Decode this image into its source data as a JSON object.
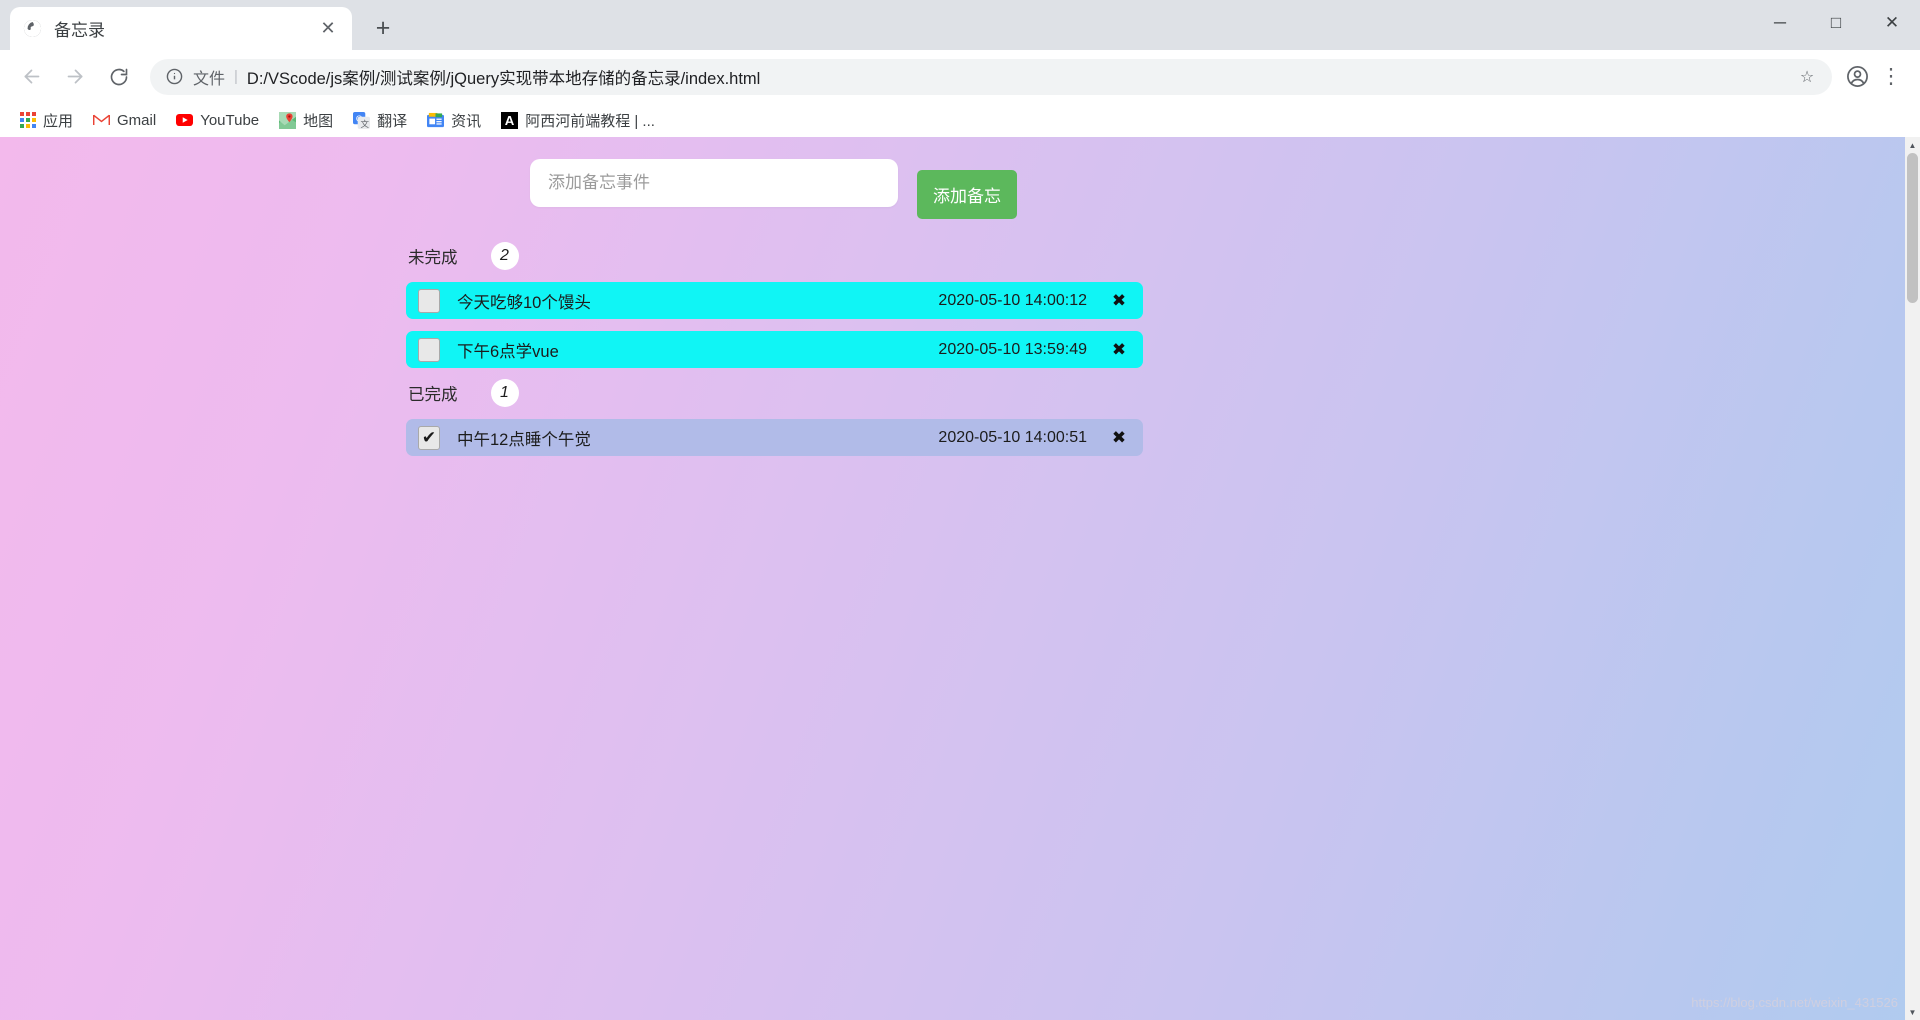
{
  "browser": {
    "tab": {
      "title": "备忘录",
      "favicon_icon": "globe-icon",
      "close_icon": "✕"
    },
    "newtab_icon": "+",
    "window_controls": {
      "minimize": "─",
      "maximize": "□",
      "close": "✕"
    },
    "toolbar": {
      "back_icon": "←",
      "forward_icon": "→",
      "reload_icon": "⟳",
      "info_icon": "ⓘ",
      "url_scheme_label": "文件",
      "url_separator": "|",
      "url_text": "D:/VScode/js案例/测试案例/jQuery实现带本地存储的备忘录/index.html",
      "star_icon": "☆",
      "profile_icon": "person-icon",
      "menu_icon": "⋮"
    },
    "bookmarks": [
      {
        "label": "应用",
        "icon": "apps-grid-icon"
      },
      {
        "label": "Gmail",
        "icon": "gmail-icon"
      },
      {
        "label": "YouTube",
        "icon": "youtube-icon"
      },
      {
        "label": "地图",
        "icon": "maps-icon"
      },
      {
        "label": "翻译",
        "icon": "translate-icon"
      },
      {
        "label": "资讯",
        "icon": "news-icon"
      },
      {
        "label": "阿西河前端教程 | ...",
        "icon": "letter-a-icon"
      }
    ]
  },
  "page": {
    "add": {
      "input_value": "",
      "input_placeholder": "添加备忘事件",
      "button_label": "添加备忘"
    },
    "sections": [
      {
        "title": "未完成",
        "count": "2",
        "items": [
          {
            "text": "今天吃够10个馒头",
            "time": "2020-05-10 14:00:12",
            "checked": false,
            "delete_icon": "✖"
          },
          {
            "text": "下午6点学vue",
            "time": "2020-05-10 13:59:49",
            "checked": false,
            "delete_icon": "✖"
          }
        ]
      },
      {
        "title": "已完成",
        "count": "1",
        "items": [
          {
            "text": "中午12点睡个午觉",
            "time": "2020-05-10 14:00:51",
            "checked": true,
            "delete_icon": "✖"
          }
        ]
      }
    ],
    "watermark": "https://blog.csdn.net/weixin_431526",
    "colors": {
      "accent_green": "#5cb85c",
      "undone_row": "#10f5f5",
      "done_row": "#b1bbe8"
    }
  }
}
